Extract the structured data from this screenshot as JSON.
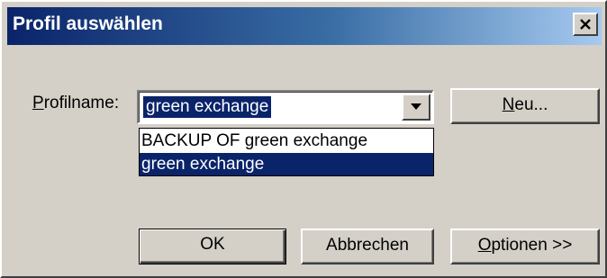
{
  "window": {
    "title": "Profil auswählen",
    "close_glyph": "✕",
    "close_icon": "close-icon"
  },
  "form": {
    "label_mnemonic": "P",
    "label_rest": "rofilname:",
    "combo_value": "green exchange",
    "combo_arrow_icon": "chevron-down-icon",
    "options": [
      "BACKUP OF green exchange",
      "green exchange"
    ],
    "selected_option_index": 1
  },
  "buttons": {
    "new_mnemonic": "N",
    "new_rest": "eu...",
    "ok_label": "OK",
    "cancel_label": "Abbrechen",
    "options_mnemonic": "O",
    "options_rest": "ptionen >>"
  },
  "colors": {
    "titlebar_start": "#0a246a",
    "titlebar_end": "#a6caf0",
    "selection": "#0a246a",
    "face": "#d4d0c8"
  }
}
